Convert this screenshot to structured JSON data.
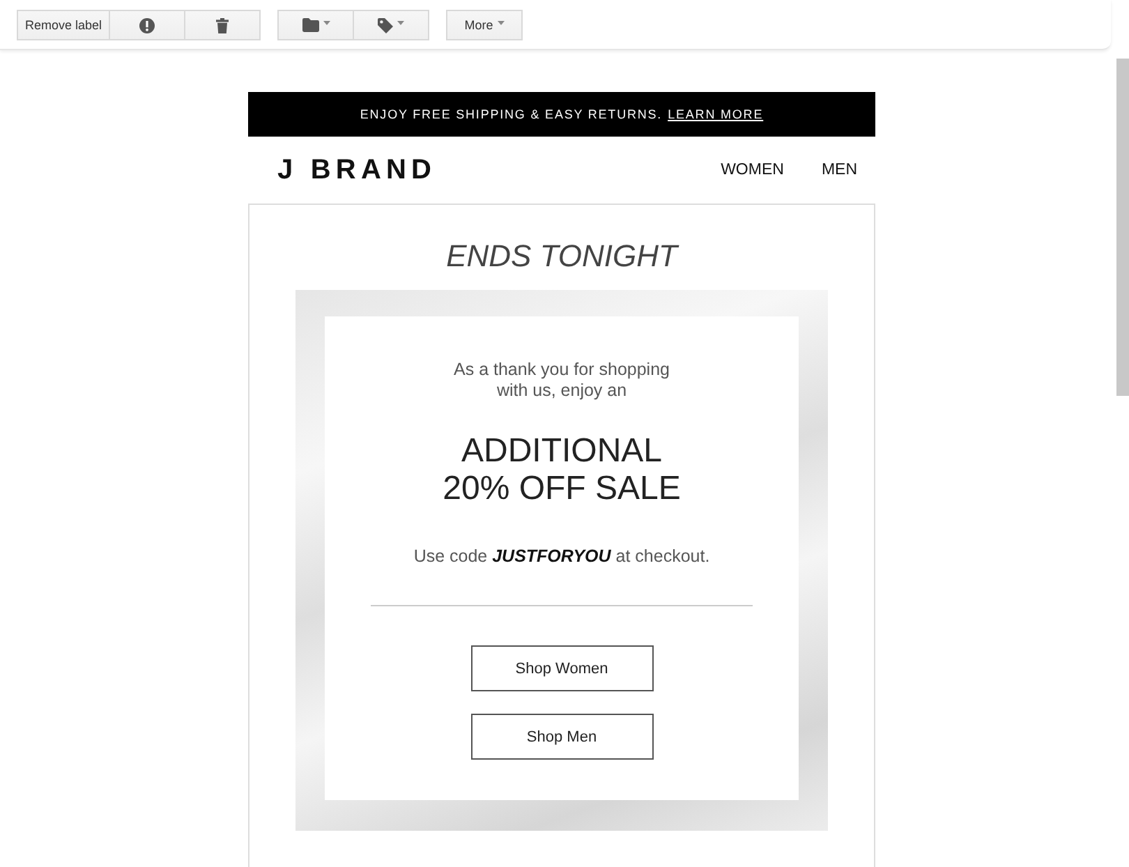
{
  "toolbar": {
    "groups": [
      {
        "buttons": [
          {
            "kind": "remove",
            "label": "Remove label"
          },
          {
            "kind": "report"
          },
          {
            "kind": "delete"
          }
        ]
      },
      {
        "buttons": [
          {
            "kind": "move"
          },
          {
            "kind": "label"
          }
        ]
      },
      {
        "buttons": [
          {
            "kind": "more",
            "label": "More"
          }
        ]
      }
    ]
  },
  "email": {
    "banner": {
      "message": "ENJOY FREE SHIPPING & EASY RETURNS.",
      "link": "LEARN MORE"
    },
    "header": {
      "logo": "J BRAND",
      "nav": [
        "WOMEN",
        "MEN"
      ]
    },
    "headline": "ENDS TONIGHT",
    "offer": {
      "intro": "As a thank you for shopping with us, enjoy an",
      "title": "ADDITIONAL 20% OFF SALE",
      "note": "Use code **JUSTFORYOU** at checkout."
    },
    "buttons": [
      "Shop Women",
      "Shop Men"
    ]
  }
}
